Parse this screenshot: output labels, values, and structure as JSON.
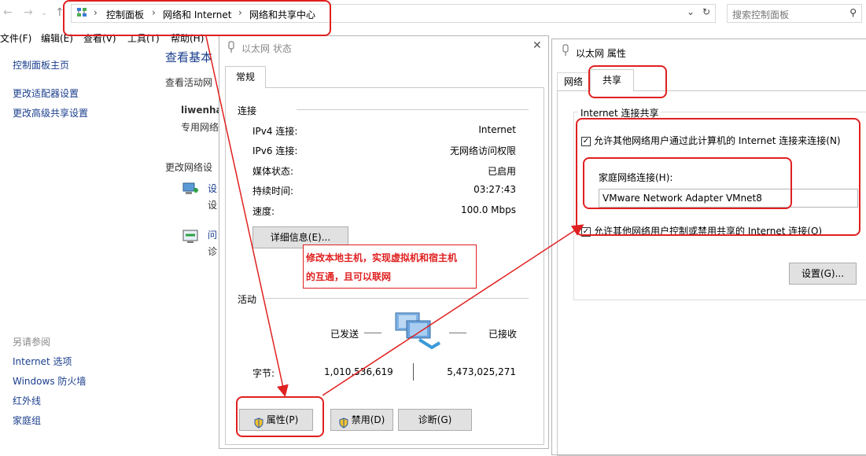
{
  "addr": {
    "breadcrumbs": [
      "控制面板",
      "网络和 Internet",
      "网络和共享中心"
    ],
    "search_placeholder": "搜索控制面板"
  },
  "menu": [
    "文件(F)",
    "编辑(E)",
    "查看(V)",
    "工具(T)",
    "帮助(H)"
  ],
  "sidebar": {
    "items": [
      "控制面板主页",
      "更改适配器设置",
      "更改高级共享设置"
    ],
    "see_also_title": "另请参阅",
    "see_also": [
      "Internet 选项",
      "Windows 防火墙",
      "红外线",
      "家庭组"
    ]
  },
  "main": {
    "heading": "查看基本",
    "active_label": "查看活动网",
    "network_name": "liwenha",
    "network_type": "专用网络",
    "change_label": "更改网络设",
    "item1_title": "设",
    "item1_sub": "设",
    "item2_title": "问",
    "item2_sub": "诊"
  },
  "status_dlg": {
    "title": "以太网 状态",
    "tab": "常规",
    "connection_section": "连接",
    "rows": [
      {
        "label": "IPv4 连接:",
        "value": "Internet"
      },
      {
        "label": "IPv6 连接:",
        "value": "无网络访问权限"
      },
      {
        "label": "媒体状态:",
        "value": "已启用"
      },
      {
        "label": "持续时间:",
        "value": "03:27:43"
      },
      {
        "label": "速度:",
        "value": "100.0 Mbps"
      }
    ],
    "details_button": "详细信息(E)...",
    "activity_section": "活动",
    "sent_label": "已发送",
    "recv_label": "已接收",
    "bytes_label": "字节:",
    "bytes_sent": "1,010,536,619",
    "bytes_recv": "5,473,025,271",
    "properties_button": "属性(P)",
    "disable_button": "禁用(D)",
    "diagnose_button": "诊断(G)"
  },
  "props_dlg": {
    "title": "以太网 属性",
    "tabs": [
      "网络",
      "共享"
    ],
    "group_title": "Internet 连接共享",
    "allow_connect": "允许其他网络用户通过此计算机的 Internet 连接来连接(N)",
    "home_label": "家庭网络连接(H):",
    "home_value": "VMware Network Adapter VMnet8",
    "allow_control": "允许其他网络用户控制或禁用共享的 Internet 连接(O)",
    "settings_button": "设置(G)..."
  },
  "annotation": {
    "line1": "修改本地主机，实现虚拟机和宿主机",
    "line2": "的互通，且可以联网"
  },
  "colors": {
    "accent": "#1a3e8c",
    "annotation": "#e02020"
  }
}
